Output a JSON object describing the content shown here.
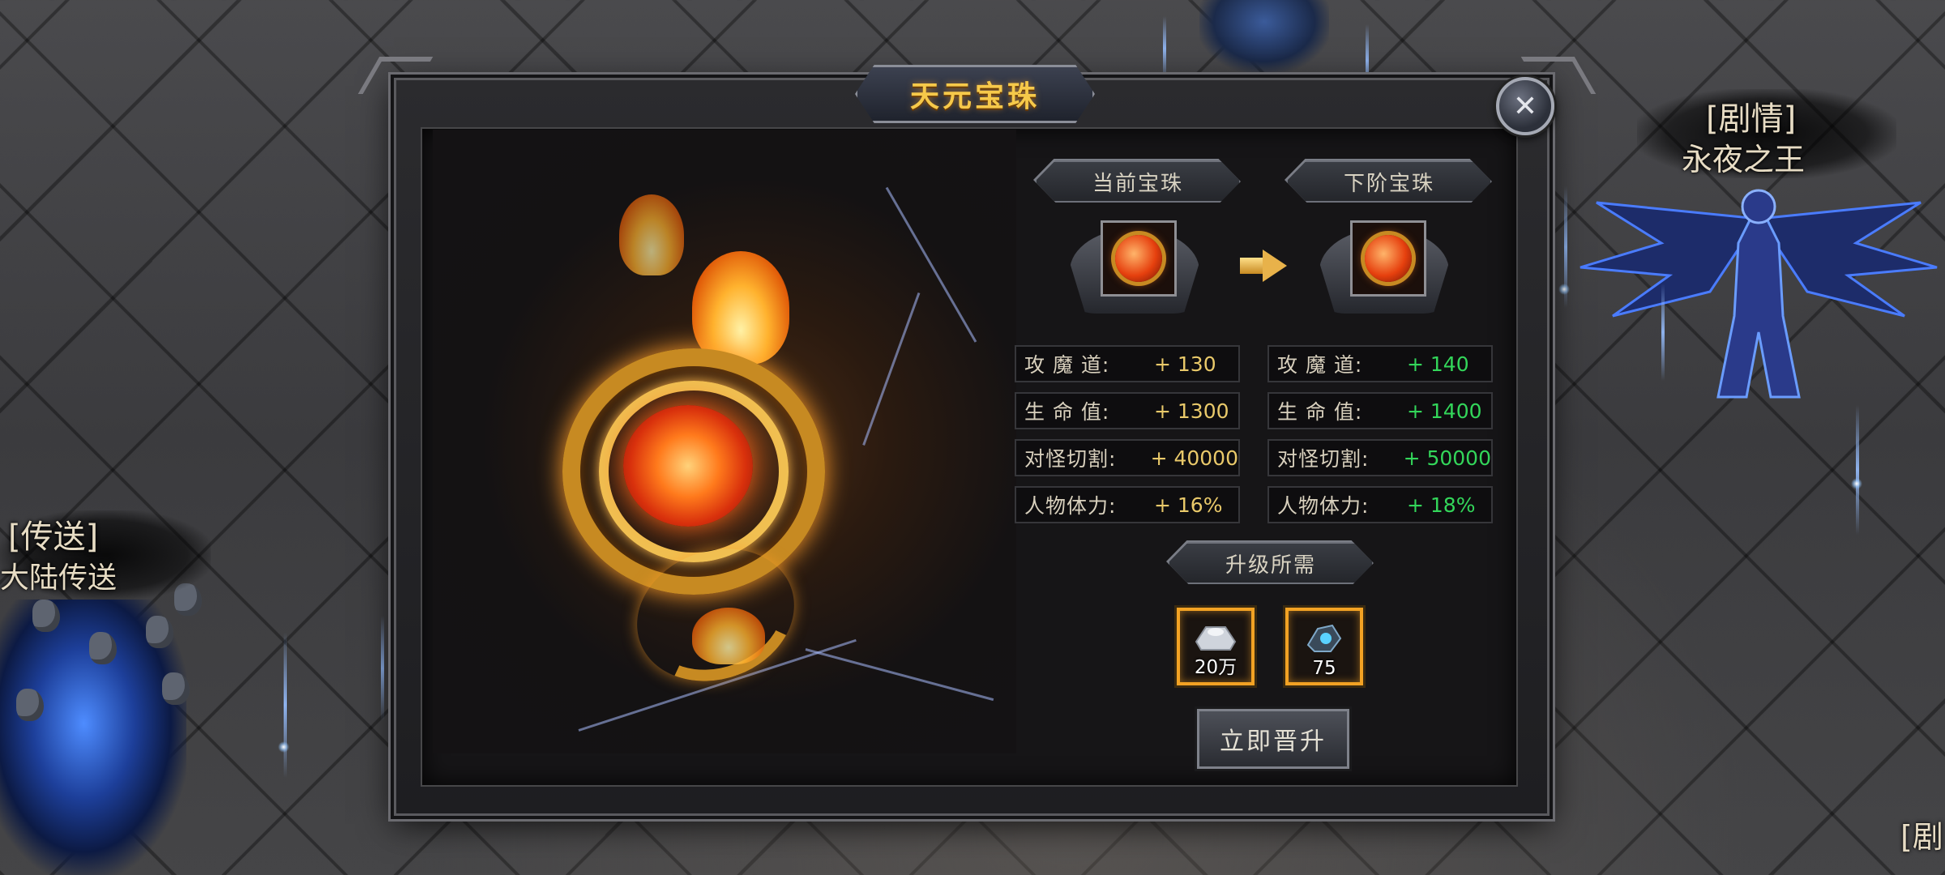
{
  "panel": {
    "title": "天元宝珠",
    "close_icon": "close-icon"
  },
  "current": {
    "header": "当前宝珠",
    "stats": [
      {
        "label": "攻 魔 道:",
        "value": "+ 130"
      },
      {
        "label": "生 命 值:",
        "value": "+ 1300"
      },
      {
        "label": "对怪切割:",
        "value": "+ 40000"
      },
      {
        "label": "人物体力:",
        "value": "+ 16%"
      }
    ]
  },
  "next": {
    "header": "下阶宝珠",
    "stats": [
      {
        "label": "攻 魔 道:",
        "value": "+ 140"
      },
      {
        "label": "生 命 值:",
        "value": "+ 1400"
      },
      {
        "label": "对怪切割:",
        "value": "+ 50000"
      },
      {
        "label": "人物体力:",
        "value": "+ 18%"
      }
    ]
  },
  "requirements": {
    "header": "升级所需",
    "items": [
      {
        "icon": "silver-ingot-icon",
        "amount": "20万"
      },
      {
        "icon": "blue-crystal-icon",
        "amount": "75"
      }
    ]
  },
  "upgrade_button": "立即晋升",
  "world": {
    "left_tag": "[传送]",
    "left_name": "大陆传送",
    "right_tag": "[剧情]",
    "right_name": "永夜之王",
    "corner_tag": "[剧"
  },
  "colors": {
    "title_gold": "#f6c94a",
    "current_value": "#e9c96a",
    "next_value": "#33d65a",
    "req_border": "#f2a224"
  }
}
